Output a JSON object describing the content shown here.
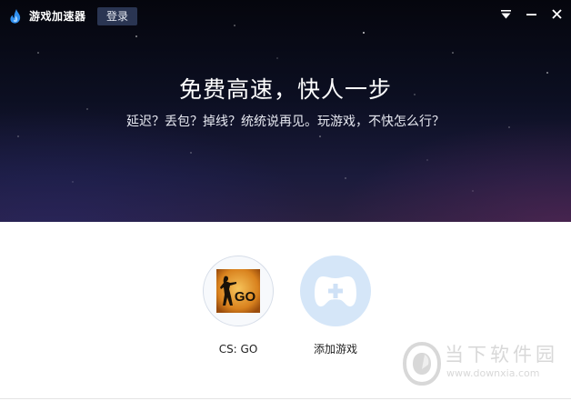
{
  "header": {
    "app_title": "游戏加速器",
    "login_label": "登录",
    "controls": {
      "menu_icon": "dropdown-triangle-icon",
      "minimize_icon": "minimize-icon",
      "close_icon": "close-icon"
    }
  },
  "hero": {
    "headline": "免费高速，快人一步",
    "subline": "延迟？丢包？掉线？统统说再见。玩游戏，不快怎么行？"
  },
  "games": [
    {
      "label": "CS: GO",
      "icon": "csgo-game-icon",
      "icon_text": "GO"
    },
    {
      "label": "添加游戏",
      "icon": "gamepad-plus-icon"
    }
  ],
  "watermark": {
    "text": "当下软件园",
    "url": "www.downxia.com"
  },
  "colors": {
    "accent": "#d5e6f8",
    "login_bg": "#2a3552",
    "hero_top": "#05060d",
    "hero_bottom": "#2a2040"
  }
}
